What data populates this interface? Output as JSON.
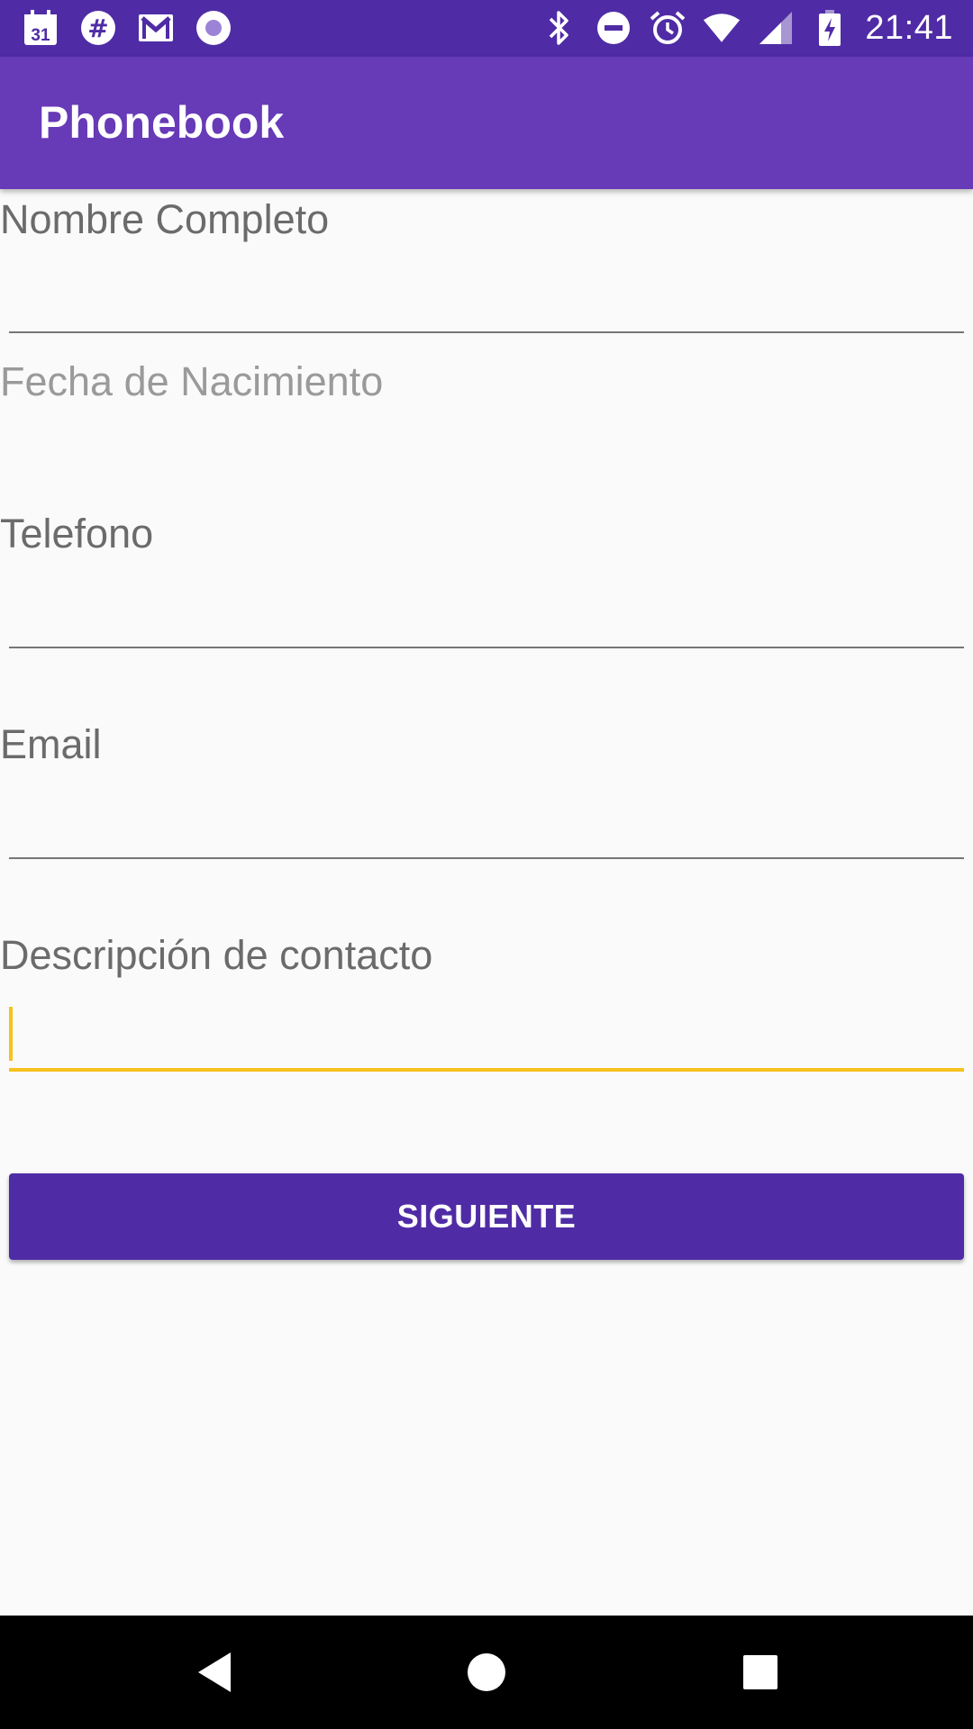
{
  "status_bar": {
    "time": "21:41",
    "left_icons": [
      "calendar-icon",
      "slack-icon",
      "gmail-icon",
      "circle-app-icon"
    ],
    "calendar_day": "31",
    "right_icons": [
      "bluetooth-icon",
      "do-not-disturb-icon",
      "alarm-icon",
      "wifi-icon",
      "signal-icon",
      "battery-charging-icon"
    ]
  },
  "app_bar": {
    "title": "Phonebook"
  },
  "form": {
    "full_name_label": "Nombre Completo",
    "full_name_value": "",
    "birthdate_hint": "Fecha de Nacimiento",
    "phone_label": "Telefono",
    "phone_value": "",
    "email_label": "Email",
    "email_value": "",
    "description_label": "Descripción de contacto",
    "description_value": ""
  },
  "button": {
    "next_label": "SIGUIENTE"
  },
  "nav_bar": {
    "icons": [
      "back-icon",
      "home-icon",
      "recents-icon"
    ]
  },
  "colors": {
    "status_bar": "#4f2ca5",
    "app_bar": "#673ab7",
    "button": "#4f2ca5",
    "focus_accent": "#f6c21c",
    "background": "#fafafa"
  }
}
